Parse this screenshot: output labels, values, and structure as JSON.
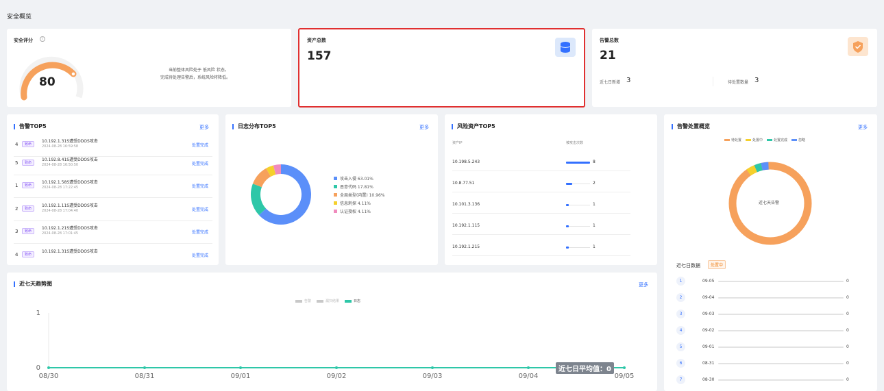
{
  "page_title": "安全概览",
  "score_card": {
    "title": "安全评分",
    "info_icon": "info-icon",
    "score": "80",
    "text1": "当前整体风险处于 低风险 状态。",
    "text2": "完成待处理告警后，系统风险将降低。"
  },
  "asset_card": {
    "title": "资产总数",
    "value": "157",
    "icon": "database-icon",
    "icon_bg": "#dce8fb"
  },
  "alert_card": {
    "title": "告警总数",
    "value": "21",
    "icon": "shield-icon",
    "icon_bg": "#fde5cf",
    "new_label": "近七日新增",
    "new_value": "3",
    "pending_label": "待处置数量",
    "pending_value": "3"
  },
  "alert_top5": {
    "title": "告警TOP5",
    "more": "更多",
    "rows": [
      {
        "rank": "4",
        "tag": "致命",
        "title": "10.192.1.31S遭受DDOS攻击",
        "time": "2024-08-28 16:59:58",
        "action": "处置完成"
      },
      {
        "rank": "5",
        "tag": "致命",
        "title": "10.192.8.41S遭受DDOS攻击",
        "time": "2024-08-28 16:50:50",
        "action": "处置完成"
      },
      {
        "rank": "1",
        "tag": "致命",
        "title": "10.192.1.58S遭受DDOS攻击",
        "time": "2024-08-28 17:22:45",
        "action": "处置完成"
      },
      {
        "rank": "2",
        "tag": "致命",
        "title": "10.192.1.11S遭受DDOS攻击",
        "time": "2024-08-28 17:04:40",
        "action": "处置完成"
      },
      {
        "rank": "3",
        "tag": "致命",
        "title": "10.192.1.21S遭受DDOS攻击",
        "time": "2024-08-28 17:01:45",
        "action": "处置完成"
      },
      {
        "rank": "4",
        "tag": "致命",
        "title": "10.192.1.31S遭受DDOS攻击",
        "time": "",
        "action": "处置完成"
      }
    ]
  },
  "log_top5": {
    "title": "日志分布TOP5",
    "more": "更多",
    "legend": [
      {
        "label": "攻击入侵  63.01%",
        "value": 63.01,
        "color": "#5b8ff9"
      },
      {
        "label": "恶意代码  17.81%",
        "value": 17.81,
        "color": "#2ec7a8"
      },
      {
        "label": "全局类型(内置)  10.96%",
        "value": 10.96,
        "color": "#f6a15c"
      },
      {
        "label": "信息刺探  4.11%",
        "value": 4.11,
        "color": "#f5d02c"
      },
      {
        "label": "认证授权  4.11%",
        "value": 4.11,
        "color": "#f08bbd"
      }
    ]
  },
  "risk_top5": {
    "title": "风险资产TOP5",
    "col_ip": "资产IP",
    "col_count": "被攻击次数",
    "max": 8,
    "rows": [
      {
        "ip": "10.198.5.243",
        "count": 8
      },
      {
        "ip": "10.8.77.51",
        "count": 2
      },
      {
        "ip": "10.101.3.136",
        "count": 1
      },
      {
        "ip": "10.192.1.115",
        "count": 1
      },
      {
        "ip": "10.192.1.215",
        "count": 1
      }
    ]
  },
  "alert_overview": {
    "title": "告警处置概览",
    "more": "更多",
    "legend": [
      {
        "label": "待处置",
        "color": "#f6a15c"
      },
      {
        "label": "处置中",
        "color": "#f5d02c"
      },
      {
        "label": "处置完成",
        "color": "#2ec7a8"
      },
      {
        "label": "忽略",
        "color": "#5b8ff9"
      }
    ],
    "center_label": "近七天告警",
    "recent_label": "近七日数据",
    "recent_tag": "处置中",
    "days": [
      {
        "rank": "1",
        "date": "09-05",
        "value": "0"
      },
      {
        "rank": "2",
        "date": "09-04",
        "value": "0"
      },
      {
        "rank": "3",
        "date": "09-03",
        "value": "0"
      },
      {
        "rank": "4",
        "date": "09-02",
        "value": "0"
      },
      {
        "rank": "5",
        "date": "09-01",
        "value": "0"
      },
      {
        "rank": "6",
        "date": "08-31",
        "value": "0"
      },
      {
        "rank": "7",
        "date": "08-30",
        "value": "0"
      }
    ]
  },
  "trend": {
    "title": "近七天趋势图",
    "more": "更多",
    "legend": [
      {
        "label": "告警",
        "color": "#c8c8c8"
      },
      {
        "label": "漏扫结果",
        "color": "#c8c8c8"
      },
      {
        "label": "日志",
        "color": "#2ec7a8"
      }
    ],
    "avg_label": "近七日平均值：0"
  },
  "chart_data": {
    "type": "line",
    "x": [
      "08/30",
      "08/31",
      "09/01",
      "09/02",
      "09/03",
      "09/04",
      "09/05"
    ],
    "series": [
      {
        "name": "日志",
        "values": [
          0,
          0,
          0,
          0,
          0,
          0,
          0
        ]
      }
    ],
    "yticks": [
      "0",
      "1"
    ],
    "ylim": [
      0,
      1
    ]
  }
}
